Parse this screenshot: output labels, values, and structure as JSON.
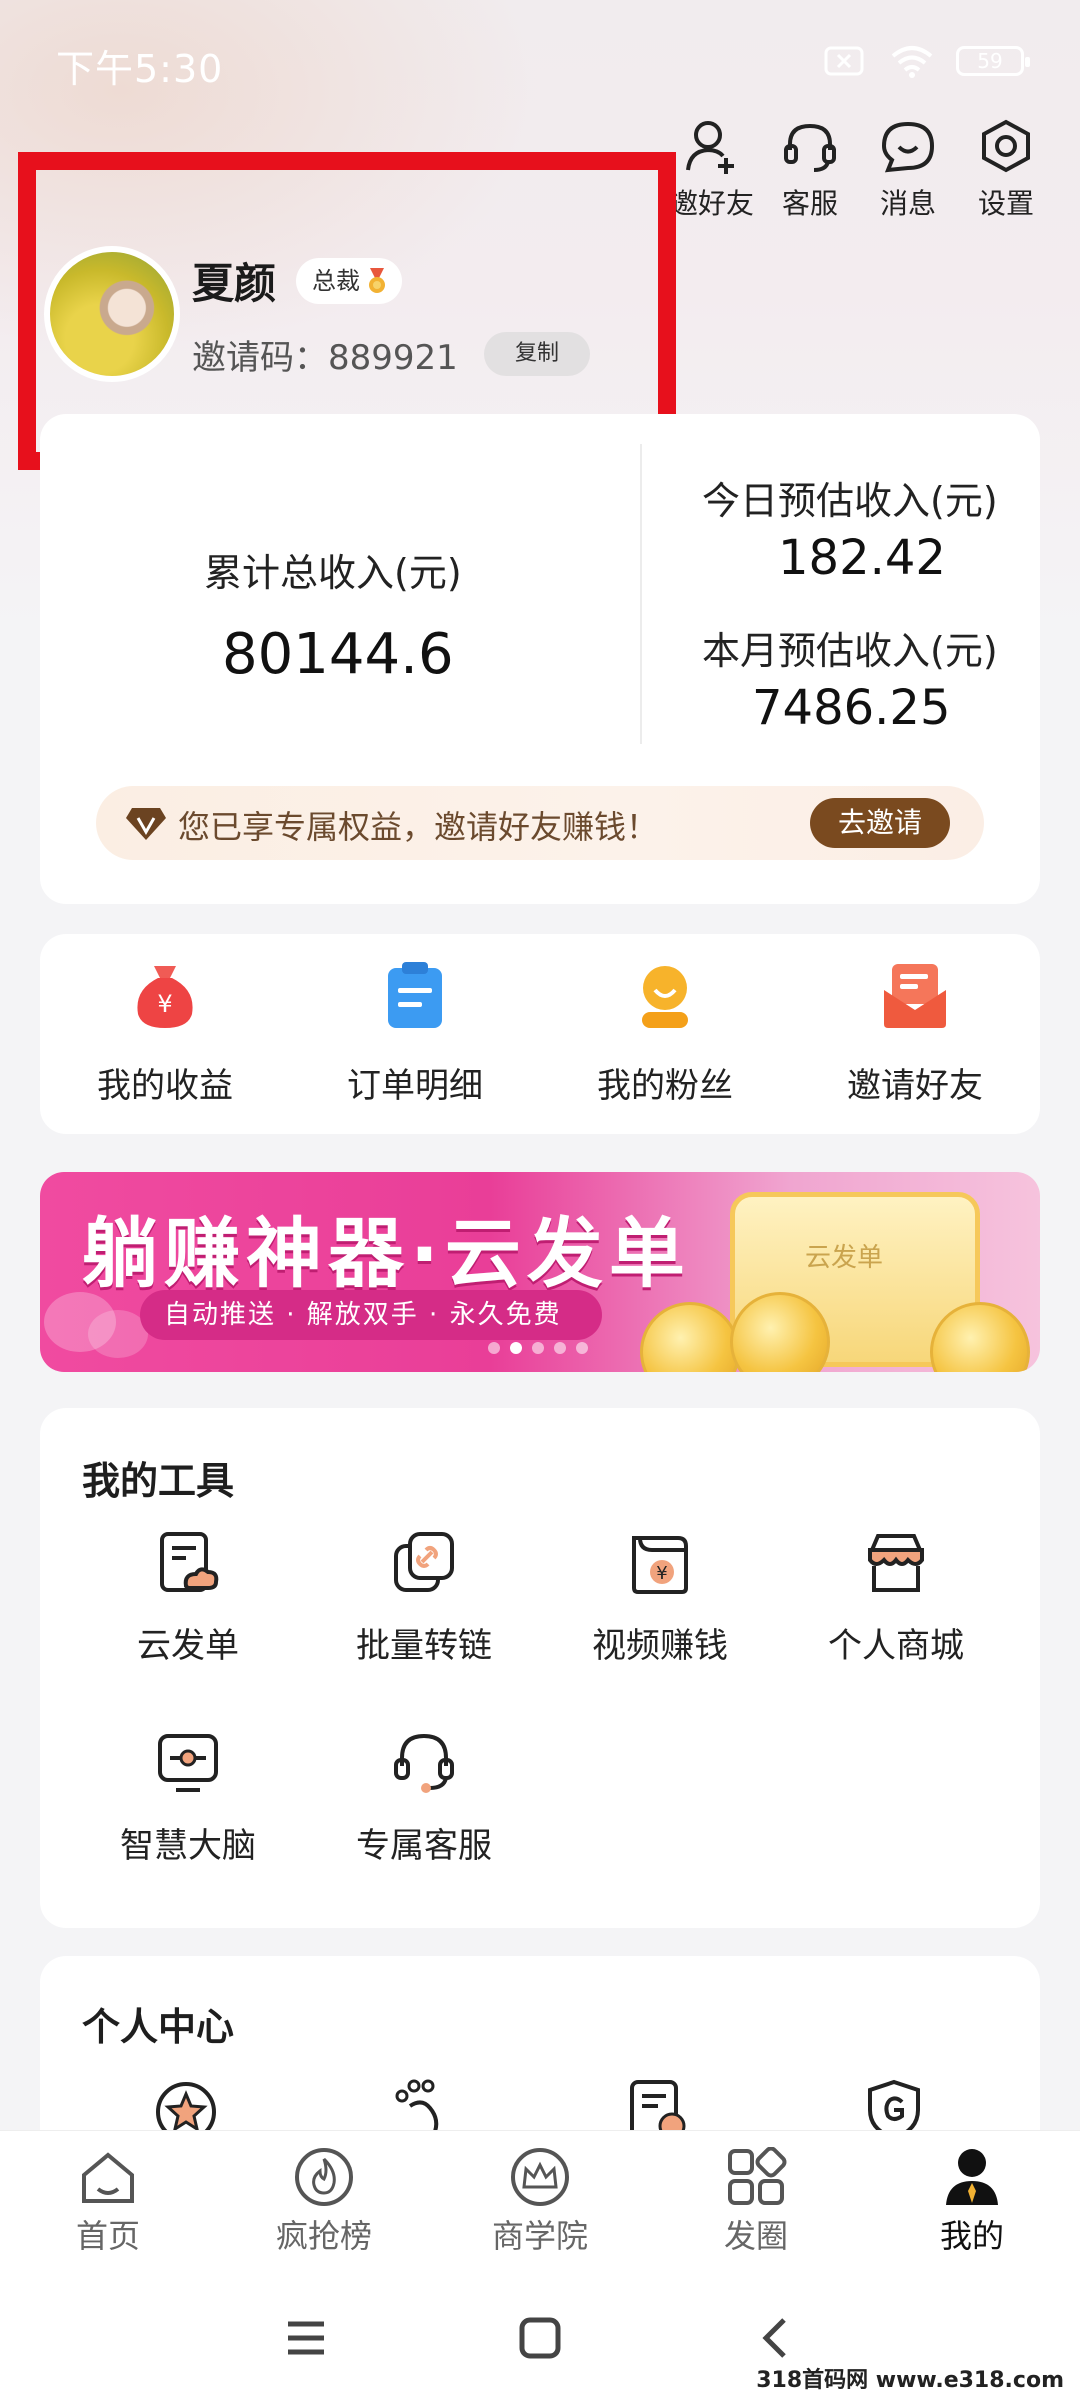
{
  "status_bar": {
    "time": "下午5:30",
    "battery": "59"
  },
  "header_actions": [
    {
      "label": "邀好友",
      "icon": "user-add-icon"
    },
    {
      "label": "客服",
      "icon": "headset-icon"
    },
    {
      "label": "消息",
      "icon": "message-icon"
    },
    {
      "label": "设置",
      "icon": "settings-icon"
    }
  ],
  "profile": {
    "name": "夏颜",
    "level_badge": "总裁",
    "invite_code_label": "邀请码：",
    "invite_code": "889921",
    "copy_label": "复制"
  },
  "income": {
    "total_label": "累计总收入(元)",
    "total_value": "80144.6",
    "today_label": "今日预估收入(元)",
    "today_value": "182.42",
    "month_label": "本月预估收入(元)",
    "month_value": "7486.25",
    "benefit_text": "您已享专属权益，邀请好友赚钱！",
    "invite_button": "去邀请"
  },
  "shortcuts": [
    {
      "label": "我的收益",
      "icon": "money-bag-icon"
    },
    {
      "label": "订单明细",
      "icon": "clipboard-icon"
    },
    {
      "label": "我的粉丝",
      "icon": "fans-icon"
    },
    {
      "label": "邀请好友",
      "icon": "envelope-icon"
    }
  ],
  "banner": {
    "title": "躺赚神器·云发单",
    "subtitle": "自动推送 · 解放双手 · 永久免费",
    "card_label": "云发单",
    "dots_count": 5,
    "active_dot": 2
  },
  "tools": {
    "title": "我的工具",
    "items": [
      {
        "label": "云发单",
        "icon": "cloud-doc-icon"
      },
      {
        "label": "批量转链",
        "icon": "link-icon"
      },
      {
        "label": "视频赚钱",
        "icon": "video-money-icon"
      },
      {
        "label": "个人商城",
        "icon": "store-icon"
      },
      {
        "label": "智慧大脑",
        "icon": "monitor-icon"
      },
      {
        "label": "专属客服",
        "icon": "headset-icon"
      }
    ]
  },
  "personal_center": {
    "title": "个人中心",
    "icons": [
      "star-icon",
      "footprint-icon",
      "order-doc-icon",
      "shield-g-icon"
    ]
  },
  "tabbar": [
    {
      "label": "首页",
      "icon": "home-icon"
    },
    {
      "label": "疯抢榜",
      "icon": "fire-icon"
    },
    {
      "label": "商学院",
      "icon": "crown-icon"
    },
    {
      "label": "发圈",
      "icon": "grid-icon"
    },
    {
      "label": "我的",
      "icon": "person-icon",
      "active": true
    }
  ],
  "watermark": "318首码网 www.e318.com",
  "colors": {
    "highlight": "#e7101c",
    "invite_button": "#7a4a1f",
    "banner_pink": "#ea3e98"
  }
}
